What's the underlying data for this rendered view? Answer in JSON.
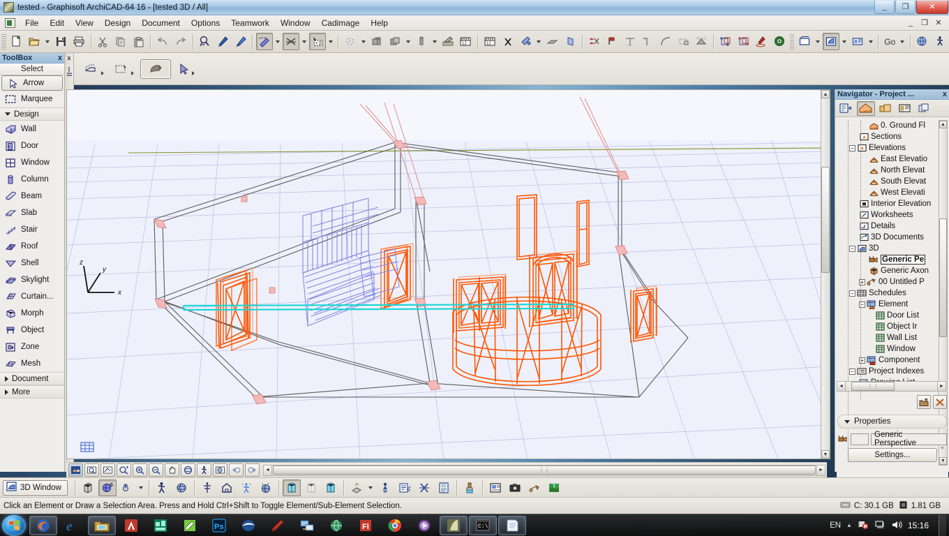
{
  "window": {
    "title": "tested - Graphisoft ArchiCAD-64 16 - [tested 3D / All]",
    "minimize": "_",
    "maximize": "❐",
    "close": "✕",
    "inner_minimize": "_",
    "inner_restore": "❐",
    "inner_close": "✕"
  },
  "menubar": {
    "items": [
      {
        "label": "File"
      },
      {
        "label": "Edit"
      },
      {
        "label": "View"
      },
      {
        "label": "Design"
      },
      {
        "label": "Document"
      },
      {
        "label": "Options"
      },
      {
        "label": "Teamwork"
      },
      {
        "label": "Window"
      },
      {
        "label": "Cadimage"
      },
      {
        "label": "Help"
      }
    ]
  },
  "toolbar": {
    "go_label": "Go",
    "buttons": [
      {
        "name": "new-icon",
        "title": "New"
      },
      {
        "name": "open-icon",
        "title": "Open"
      },
      {
        "name": "save-icon",
        "title": "Save"
      },
      {
        "name": "print-icon",
        "title": "Print"
      },
      {
        "name": "cut-icon",
        "title": "Cut"
      },
      {
        "name": "copy-icon",
        "title": "Copy"
      },
      {
        "name": "paste-icon",
        "title": "Paste"
      },
      {
        "name": "undo-icon",
        "title": "Undo"
      },
      {
        "name": "redo-icon",
        "title": "Redo"
      },
      {
        "name": "find-select-icon",
        "title": "Find & Select"
      },
      {
        "name": "pick-up-parameters-icon",
        "title": "Pick Up Parameters"
      },
      {
        "name": "inject-parameters-icon",
        "title": "Inject Parameters"
      },
      {
        "name": "magic-wand-icon",
        "title": "Magic Wand"
      },
      {
        "name": "intersect-icon",
        "title": "Intersect"
      },
      {
        "name": "marquee-settings-icon",
        "title": "Marquee"
      },
      {
        "name": "mesh-points-icon",
        "title": "Mesh Points"
      },
      {
        "name": "wall-end-icon",
        "title": "Wall End"
      },
      {
        "name": "solid-operations-icon",
        "title": "Solid Element Operations"
      },
      {
        "name": "column-icon",
        "title": "Column"
      },
      {
        "name": "pen-palette-icon",
        "title": "Pen Sets"
      },
      {
        "name": "dimension-icon",
        "title": "Dimension"
      },
      {
        "name": "measure-icon",
        "title": "Measure"
      },
      {
        "name": "multiply-icon",
        "title": "Multiply"
      },
      {
        "name": "paint-fill-icon",
        "title": "Fill"
      },
      {
        "name": "slab-icon",
        "title": "Slab"
      },
      {
        "name": "shell-icon",
        "title": "Shell"
      },
      {
        "name": "trim-icon",
        "title": "Trim"
      },
      {
        "name": "split-icon",
        "title": "Split"
      },
      {
        "name": "adjust-icon",
        "title": "Adjust"
      },
      {
        "name": "fillet-icon",
        "title": "Fillet/Chamfer"
      },
      {
        "name": "curve-icon",
        "title": "Curve"
      },
      {
        "name": "stretch-icon",
        "title": "Stretch"
      },
      {
        "name": "roof-icon",
        "title": "Roof"
      },
      {
        "name": "group-icon",
        "title": "Group"
      },
      {
        "name": "suspend-groups-icon",
        "title": "Suspend Groups"
      },
      {
        "name": "marker-icon",
        "title": "Marker"
      },
      {
        "name": "target-icon",
        "title": "Target"
      },
      {
        "name": "floor-plan-window-icon",
        "title": "Floor Plan Window"
      },
      {
        "name": "three-d-window-icon",
        "title": "3D Window"
      },
      {
        "name": "layout-window-icon",
        "title": "Layout Book"
      },
      {
        "name": "globe-icon",
        "title": "Globe"
      },
      {
        "name": "walk-icon",
        "title": "Explore Model"
      }
    ]
  },
  "toolbar2": {
    "buttons": [
      {
        "name": "edit-3d-icon",
        "title": "Edit 3D"
      },
      {
        "name": "marquee-3d-icon",
        "title": "3D Marquee"
      },
      {
        "name": "orbit-icon",
        "title": "Orbit"
      },
      {
        "name": "arrow-cursor-icon",
        "title": "Arrow"
      }
    ]
  },
  "toolbox": {
    "title": "ToolBox",
    "close": "x",
    "select_header": "Select",
    "items": [
      {
        "label": "Arrow",
        "icon": "arrow-icon",
        "selected": true,
        "type": "tool"
      },
      {
        "label": "Marquee",
        "icon": "marquee-icon",
        "selected": false,
        "type": "tool"
      },
      {
        "label": "Design",
        "icon": "caret-down-icon",
        "type": "category",
        "expanded": true
      },
      {
        "label": "Wall",
        "icon": "wall-icon",
        "type": "tool"
      },
      {
        "label": "Door",
        "icon": "door-icon",
        "type": "tool"
      },
      {
        "label": "Window",
        "icon": "window-icon",
        "type": "tool"
      },
      {
        "label": "Column",
        "icon": "column-icon",
        "type": "tool"
      },
      {
        "label": "Beam",
        "icon": "beam-icon",
        "type": "tool"
      },
      {
        "label": "Slab",
        "icon": "slab-icon",
        "type": "tool"
      },
      {
        "label": "Stair",
        "icon": "stair-icon",
        "type": "tool"
      },
      {
        "label": "Roof",
        "icon": "roof-icon",
        "type": "tool"
      },
      {
        "label": "Shell",
        "icon": "shell-icon",
        "type": "tool"
      },
      {
        "label": "Skylight",
        "icon": "skylight-icon",
        "type": "tool"
      },
      {
        "label": "Curtain...",
        "icon": "curtain-wall-icon",
        "type": "tool"
      },
      {
        "label": "Morph",
        "icon": "morph-icon",
        "type": "tool"
      },
      {
        "label": "Object",
        "icon": "object-icon",
        "type": "tool"
      },
      {
        "label": "Zone",
        "icon": "zone-icon",
        "type": "tool"
      },
      {
        "label": "Mesh",
        "icon": "mesh-icon",
        "type": "tool"
      },
      {
        "label": "Document",
        "icon": "caret-right-icon",
        "type": "category",
        "expanded": false
      },
      {
        "label": "More",
        "icon": "caret-right-icon",
        "type": "category",
        "expanded": false
      }
    ]
  },
  "navigator": {
    "title": "Navigator - Project ...",
    "close": "x",
    "tabs": [
      {
        "name": "navigator-preview-tab",
        "active": false
      },
      {
        "name": "project-map-tab",
        "active": true
      },
      {
        "name": "view-map-tab",
        "active": false
      },
      {
        "name": "layout-book-tab",
        "active": false
      },
      {
        "name": "publisher-sets-tab",
        "active": false
      }
    ],
    "tree": [
      {
        "label": "0. Ground Fl",
        "icon": "story-icon",
        "indent": 3,
        "expander": "",
        "selected": false
      },
      {
        "label": "Sections",
        "icon": "sections-icon",
        "indent": 2,
        "expander": "",
        "selected": false
      },
      {
        "label": "Elevations",
        "icon": "elevations-icon",
        "indent": 2,
        "expander": "-",
        "selected": false
      },
      {
        "label": "East Elevatio",
        "icon": "elevation-item-icon",
        "indent": 3,
        "expander": "",
        "selected": false
      },
      {
        "label": "North Elevat",
        "icon": "elevation-item-icon",
        "indent": 3,
        "expander": "",
        "selected": false
      },
      {
        "label": "South Elevat",
        "icon": "elevation-item-icon",
        "indent": 3,
        "expander": "",
        "selected": false
      },
      {
        "label": "West Elevati",
        "icon": "elevation-item-icon",
        "indent": 3,
        "expander": "",
        "selected": false
      },
      {
        "label": "Interior Elevation",
        "icon": "interior-elevation-icon",
        "indent": 2,
        "expander": "",
        "selected": false
      },
      {
        "label": "Worksheets",
        "icon": "worksheets-icon",
        "indent": 2,
        "expander": "",
        "selected": false
      },
      {
        "label": "Details",
        "icon": "details-icon",
        "indent": 2,
        "expander": "",
        "selected": false
      },
      {
        "label": "3D Documents",
        "icon": "three-d-documents-icon",
        "indent": 2,
        "expander": "",
        "selected": false
      },
      {
        "label": "3D",
        "icon": "three-d-icon",
        "indent": 2,
        "expander": "-",
        "selected": false
      },
      {
        "label": "Generic Pe",
        "icon": "camera-icon",
        "indent": 3,
        "expander": "",
        "selected": true
      },
      {
        "label": "Generic Axon",
        "icon": "axonometry-icon",
        "indent": 3,
        "expander": "",
        "selected": false
      },
      {
        "label": "00 Untitled P",
        "icon": "perspective-icon",
        "indent": 3,
        "expander": "+",
        "selected": false
      },
      {
        "label": "Schedules",
        "icon": "schedules-icon",
        "indent": 2,
        "expander": "-",
        "selected": false
      },
      {
        "label": "Element",
        "icon": "element-icon",
        "indent": 3,
        "expander": "-",
        "selected": false
      },
      {
        "label": "Door List",
        "icon": "list-icon",
        "indent": 4,
        "expander": "",
        "selected": false
      },
      {
        "label": "Object Ir",
        "icon": "list-icon",
        "indent": 4,
        "expander": "",
        "selected": false
      },
      {
        "label": "Wall List",
        "icon": "list-icon",
        "indent": 4,
        "expander": "",
        "selected": false
      },
      {
        "label": "Window",
        "icon": "list-icon",
        "indent": 4,
        "expander": "",
        "selected": false
      },
      {
        "label": "Component",
        "icon": "component-icon",
        "indent": 3,
        "expander": "+",
        "selected": false
      },
      {
        "label": "Project Indexes",
        "icon": "project-indexes-icon",
        "indent": 2,
        "expander": "-",
        "selected": false
      },
      {
        "label": "Drawing List",
        "icon": "drawing-list-icon",
        "indent": 3,
        "expander": "",
        "selected": false
      }
    ],
    "actions": [
      {
        "name": "new-folder-button"
      },
      {
        "name": "delete-button"
      }
    ],
    "properties_label": "Properties",
    "perspective_value": "Generic Perspective",
    "settings_label": "Settings..."
  },
  "viewport": {
    "axis_x": "x",
    "axis_y": "y",
    "axis_z": "z",
    "colors": {
      "background": "#eef1fb",
      "grid": "#aab4e0",
      "selected_element": "#ff5a00",
      "stair": "#8f8fe8",
      "highlight": "#2ee8e8",
      "wall_outline": "#5b5b5b",
      "reference": "#e88a8a",
      "green_line": "#7f8c2a"
    }
  },
  "viewnav": {
    "buttons": [
      {
        "name": "fit-in-window-button",
        "active": true
      },
      {
        "name": "zoom-area-button",
        "active": false
      },
      {
        "name": "previous-zoom-button",
        "active": false
      },
      {
        "name": "zoom-in-out-button",
        "active": false
      },
      {
        "name": "zoom-in-button",
        "active": false
      },
      {
        "name": "zoom-out-button",
        "active": false
      },
      {
        "name": "pan-button",
        "active": false
      },
      {
        "name": "orbit-button",
        "active": false
      },
      {
        "name": "explore-model-button",
        "active": false
      },
      {
        "name": "fit-selection-button",
        "active": false
      },
      {
        "name": "zoom-back-button",
        "active": false
      },
      {
        "name": "zoom-forward-button",
        "active": false
      }
    ]
  },
  "bottombar": {
    "window_button_label": "3D Window",
    "buttons": [
      {
        "name": "3d-cutaway-icon"
      },
      {
        "name": "3d-view-mode-icon",
        "active": true
      },
      {
        "name": "3d-projection-icon"
      },
      {
        "name": "explore-model-icon"
      },
      {
        "name": "3d-style-icon"
      },
      {
        "name": "3d-all-elements-icon"
      },
      {
        "name": "3d-home-icon"
      },
      {
        "name": "3d-marked-distant-icon"
      },
      {
        "name": "3d-filter-icon"
      },
      {
        "name": "copy-3d-icon",
        "active": true
      },
      {
        "name": "cut-3d-icon"
      },
      {
        "name": "paste-3d-icon"
      },
      {
        "name": "3d-cutting-planes-icon"
      },
      {
        "name": "3d-sun-icon"
      },
      {
        "name": "3d-render-settings-icon"
      },
      {
        "name": "3d-cut-icon"
      },
      {
        "name": "3d-document-icon"
      },
      {
        "name": "3d-paint-icon"
      },
      {
        "name": "save-view-icon"
      },
      {
        "name": "photo-render-icon"
      },
      {
        "name": "animation-icon"
      },
      {
        "name": "google-earth-icon"
      }
    ]
  },
  "statusbar": {
    "message": "Click an Element or Draw a Selection Area. Press and Hold Ctrl+Shift to Toggle Element/Sub-Element Selection.",
    "disk": "C: 30.1 GB",
    "memory": "1.81 GB"
  },
  "taskbar": {
    "apps": [
      {
        "name": "firefox-taskbar-icon",
        "open": true
      },
      {
        "name": "internet-explorer-taskbar-icon",
        "open": false
      },
      {
        "name": "windows-explorer-taskbar-icon",
        "open": true
      },
      {
        "name": "autocad-taskbar-icon",
        "open": false
      },
      {
        "name": "sketch-app-taskbar-icon",
        "open": false
      },
      {
        "name": "evernote-taskbar-icon",
        "open": false
      },
      {
        "name": "photoshop-taskbar-icon",
        "open": false
      },
      {
        "name": "sketchup-taskbar-icon",
        "open": false
      },
      {
        "name": "corel-taskbar-icon",
        "open": false
      },
      {
        "name": "remote-desktop-taskbar-icon",
        "open": false
      },
      {
        "name": "globe-app-taskbar-icon",
        "open": false
      },
      {
        "name": "flash-taskbar-icon",
        "open": false
      },
      {
        "name": "chrome-taskbar-icon",
        "open": false
      },
      {
        "name": "media-player-taskbar-icon",
        "open": false
      },
      {
        "name": "archicad-taskbar-icon",
        "open": true
      },
      {
        "name": "command-prompt-taskbar-icon",
        "open": true
      },
      {
        "name": "notepad-taskbar-icon",
        "open": true
      }
    ],
    "tray": {
      "language": "EN",
      "clock": "15:16",
      "icons": [
        "antivirus-tray-icon",
        "network-tray-icon",
        "volume-tray-icon"
      ]
    }
  }
}
